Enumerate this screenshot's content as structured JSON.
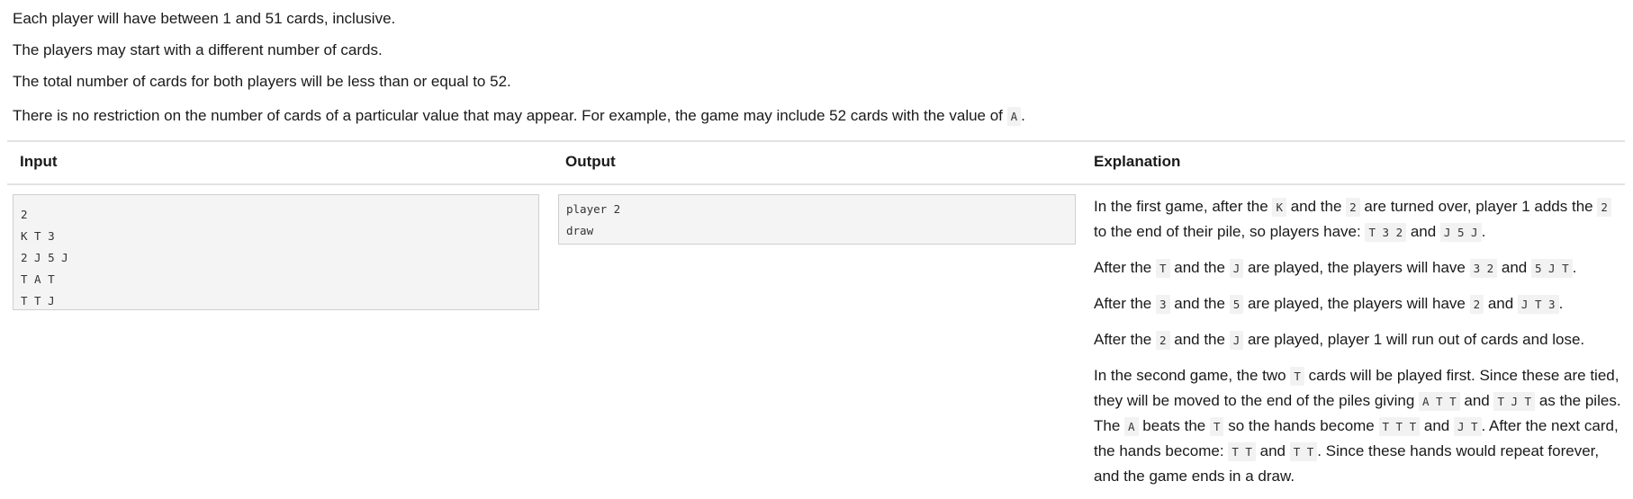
{
  "intro": [
    "Each player will have between 1 and 51 cards, inclusive.",
    "The players may start with a different number of cards.",
    "The total number of cards for both players will be less than or equal to 52."
  ],
  "restriction": {
    "text": "There is no restriction on the number of cards of a particular value that may appear. For example, the game may include 52 cards with the value of ",
    "code": "A",
    "end": "."
  },
  "table": {
    "headers": [
      "Input",
      "Output",
      "Explanation"
    ],
    "input_lines": [
      "2",
      "K T 3",
      "2 J 5 J",
      "T A T",
      "T T J"
    ],
    "output_lines": [
      "player 2",
      "draw"
    ],
    "explanation": [
      [
        {
          "t": "In the first game, after the "
        },
        {
          "c": "K"
        },
        {
          "t": " and the "
        },
        {
          "c": "2"
        },
        {
          "t": " are turned over, player 1 adds the "
        },
        {
          "c": "2"
        },
        {
          "t": " to the end of their pile, so players have: "
        },
        {
          "c": "T 3 2"
        },
        {
          "t": " and "
        },
        {
          "c": "J 5 J"
        },
        {
          "t": "."
        }
      ],
      [
        {
          "t": "After the "
        },
        {
          "c": "T"
        },
        {
          "t": " and the "
        },
        {
          "c": "J"
        },
        {
          "t": " are played, the players will have "
        },
        {
          "c": "3 2"
        },
        {
          "t": " and "
        },
        {
          "c": "5 J T"
        },
        {
          "t": "."
        }
      ],
      [
        {
          "t": "After the "
        },
        {
          "c": "3"
        },
        {
          "t": " and the "
        },
        {
          "c": "5"
        },
        {
          "t": " are played, the players will have "
        },
        {
          "c": "2"
        },
        {
          "t": " and "
        },
        {
          "c": "J T 3"
        },
        {
          "t": "."
        }
      ],
      [
        {
          "t": "After the "
        },
        {
          "c": "2"
        },
        {
          "t": " and the "
        },
        {
          "c": "J"
        },
        {
          "t": " are played, player 1 will run out of cards and lose."
        }
      ],
      [
        {
          "t": "In the second game, the two "
        },
        {
          "c": "T"
        },
        {
          "t": " cards will be played first. Since these are tied, they will be moved to the end of the piles giving "
        },
        {
          "c": "A T T"
        },
        {
          "t": " and "
        },
        {
          "c": "T J T"
        },
        {
          "t": " as the piles. The "
        },
        {
          "c": "A"
        },
        {
          "t": " beats the "
        },
        {
          "c": "T"
        },
        {
          "t": " so the hands become "
        },
        {
          "c": "T T T"
        },
        {
          "t": " and "
        },
        {
          "c": "J T"
        },
        {
          "t": ". After the next card, the hands become: "
        },
        {
          "c": "T T"
        },
        {
          "t": " and "
        },
        {
          "c": "T T"
        },
        {
          "t": ". Since these hands would repeat forever, and the game ends in a draw."
        }
      ]
    ]
  }
}
